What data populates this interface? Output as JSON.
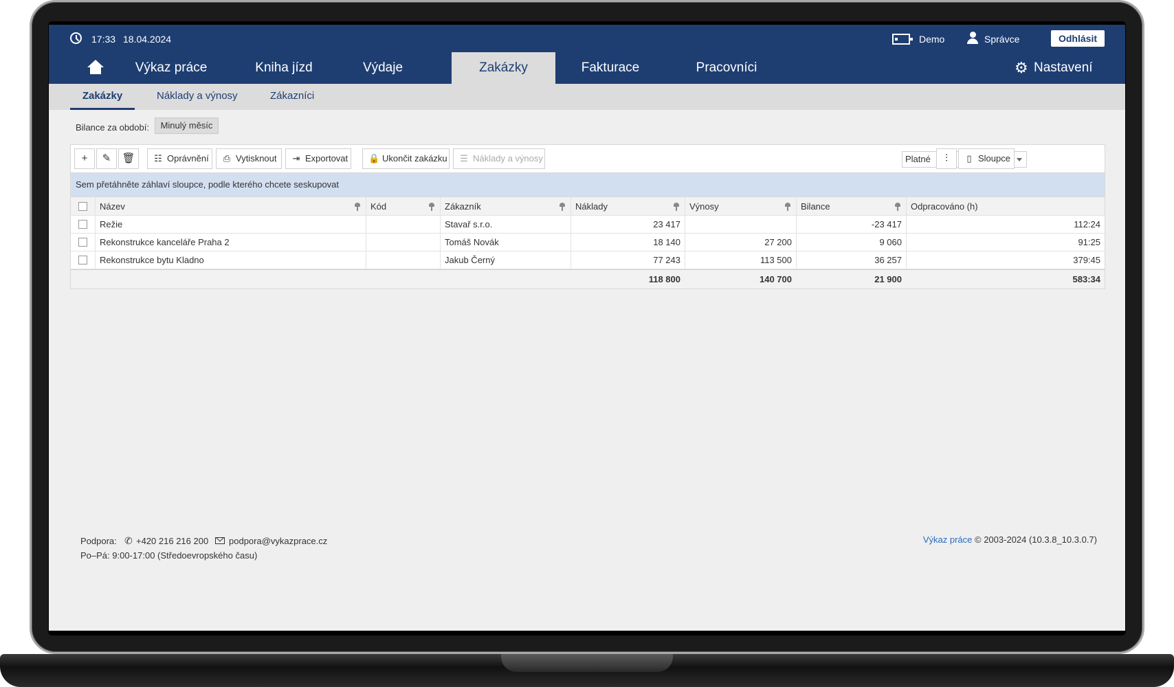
{
  "header": {
    "time": "17:33",
    "date": "18.04.2024",
    "company": "Demo",
    "user": "Správce",
    "logout_label": "Odhlásit"
  },
  "nav": {
    "tabs": [
      "Výkaz práce",
      "Kniha jízd",
      "Výdaje",
      "Zakázky",
      "Fakturace",
      "Pracovníci"
    ],
    "active_tab": "Zakázky",
    "settings_label": "Nastavení"
  },
  "subnav": {
    "tabs": [
      "Zakázky",
      "Náklady a výnosy",
      "Zákazníci"
    ],
    "active": "Zakázky"
  },
  "period": {
    "label": "Bilance za období:",
    "value": "Minulý měsíc"
  },
  "toolbar": {
    "permissions": "Oprávnění",
    "print": "Vytisknout",
    "export": "Exportovat",
    "close_job": "Ukončit zakázku",
    "costs_revenues": "Náklady a výnosy",
    "filter_value": "Platné",
    "columns": "Sloupce"
  },
  "group_panel_text": "Sem přetáhněte záhlaví sloupce, podle kterého chcete seskupovat",
  "table": {
    "columns": [
      "Název",
      "Kód",
      "Zákazník",
      "Náklady",
      "Výnosy",
      "Bilance",
      "Odpracováno (h)"
    ],
    "rows": [
      [
        "Režie",
        "",
        "Stavař s.r.o.",
        "23 417",
        "",
        "-23 417",
        "112:24"
      ],
      [
        "Rekonstrukce kanceláře Praha 2",
        "",
        "Tomáš Novák",
        "18 140",
        "27 200",
        "9 060",
        "91:25"
      ],
      [
        "Rekonstrukce bytu Kladno",
        "",
        "Jakub Černý",
        "77 243",
        "113 500",
        "36 257",
        "379:45"
      ]
    ],
    "totals": [
      "",
      "",
      "",
      "118 800",
      "140 700",
      "21 900",
      "583:34"
    ]
  },
  "footer": {
    "support_label": "Podpora:",
    "phone": "+420 216 216 200",
    "email": "podpora@vykazprace.cz",
    "hours": "Po–Pá: 9:00-17:00 (Středoevropského času)",
    "product_link": "Výkaz práce",
    "copyright": "© 2003-2024 (10.3.8_10.3.0.7)"
  },
  "colors": {
    "brand_navy": "#1e3e72",
    "group_panel": "#d2dff1",
    "link": "#2a6bbf"
  }
}
